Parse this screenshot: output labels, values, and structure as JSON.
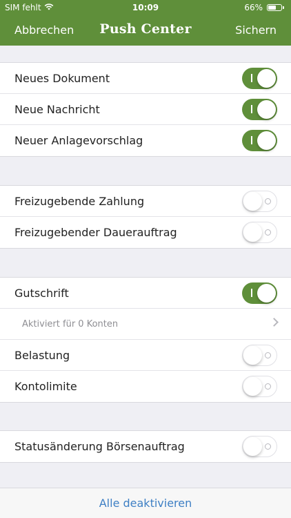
{
  "status_bar": {
    "carrier": "SIM fehlt",
    "time": "10:09",
    "battery_percent": "66%",
    "battery_level": 0.66
  },
  "nav": {
    "cancel_label": "Abbrechen",
    "title": "Push Center",
    "save_label": "Sichern"
  },
  "groups": [
    {
      "rows": [
        {
          "label": "Neues Dokument",
          "enabled": true
        },
        {
          "label": "Neue Nachricht",
          "enabled": true
        },
        {
          "label": "Neuer Anlagevorschlag",
          "enabled": true
        }
      ]
    },
    {
      "rows": [
        {
          "label": "Freizugebende Zahlung",
          "enabled": false
        },
        {
          "label": "Freizugebender Dauerauftrag",
          "enabled": false
        }
      ]
    },
    {
      "rows": [
        {
          "label": "Gutschrift",
          "enabled": true
        },
        {
          "label": "Aktiviert für 0 Konten",
          "type": "disclosure"
        },
        {
          "label": "Belastung",
          "enabled": false
        },
        {
          "label": "Kontolimite",
          "enabled": false
        }
      ]
    },
    {
      "rows": [
        {
          "label": "Statusänderung Börsenauftrag",
          "enabled": false
        }
      ]
    }
  ],
  "footer": {
    "deactivate_all_label": "Alle deaktivieren"
  },
  "colors": {
    "brand_green": "#5f8f3a",
    "link_blue": "#3e7fc4",
    "background": "#efeff4"
  }
}
